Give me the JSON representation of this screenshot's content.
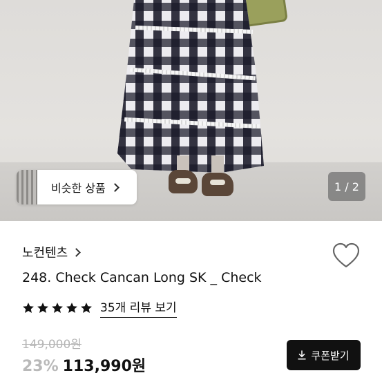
{
  "gallery": {
    "similar_label": "비슷한 상품",
    "page_indicator": "1 / 2"
  },
  "product": {
    "brand": "노컨텐츠",
    "title": "248. Check Cancan Long SK _ Check",
    "rating": 5,
    "review_link": "35개 리뷰 보기",
    "original_price": "149,000원",
    "discount": "23%",
    "sale_price": "113,990원"
  },
  "actions": {
    "coupon_label": "쿠폰받기"
  },
  "icons": {
    "wishlist": "heart-outline-icon",
    "stars": "star-icon",
    "coupon": "download-icon",
    "chevron": "chevron-right-icon"
  },
  "colors": {
    "text_primary": "#111111",
    "muted_gray": "#b5b5b5",
    "coupon_button": "#111111"
  }
}
